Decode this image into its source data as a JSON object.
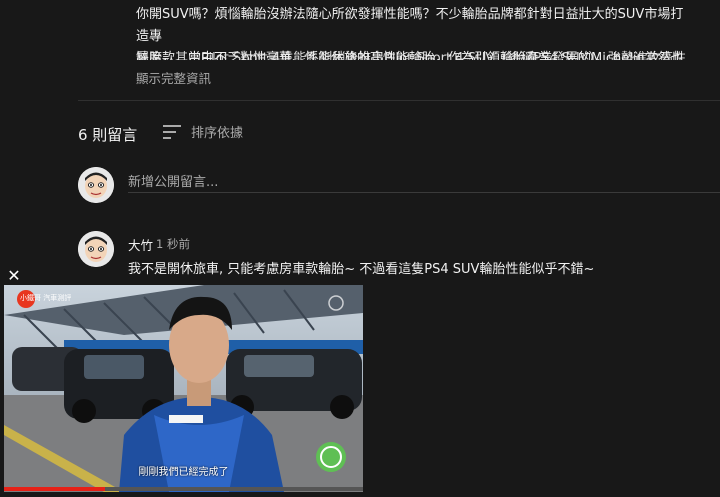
{
  "description": {
    "line1": "你開SUV嗎？煩惱輪胎沒辦法隨心所欲發揮性能嗎？不少輪胎品牌都針對日益壯大的SUV市場打造專",
    "line2": "屬胎款，當中不乏對性豪華、性能休旅的高性能輪胎，作為引領輪胎產業發展的Michelin當然也沒有",
    "line3": "缺席，其中Pilot Sport 4性能系列稍後推出Pilot Sport 4 SUV（後稱PS4 SUV），強勢進攻高性能SUV輪",
    "show_more": "顯示完整資訊"
  },
  "comments_header": {
    "count": "6 則留言",
    "sort_label": "排序依據"
  },
  "add_comment": {
    "placeholder": "新增公開留言..."
  },
  "comments": [
    {
      "author": "大竹",
      "time": "1 秒前",
      "text": "我不是開休旅車, 只能考慮房車款輪胎~ 不過看這隻PS4 SUV輪胎性能似乎不錯~"
    }
  ],
  "mini_player": {
    "close_icon": "close-icon",
    "subtitle": "剛剛我們已經完成了",
    "logo_text": "小鐵哥 汽車測評",
    "progress": 0.28
  },
  "colors": {
    "background": "#181818",
    "text": "#f1f1f1",
    "secondary_text": "#aaaaaa",
    "progress": "#e62117"
  }
}
